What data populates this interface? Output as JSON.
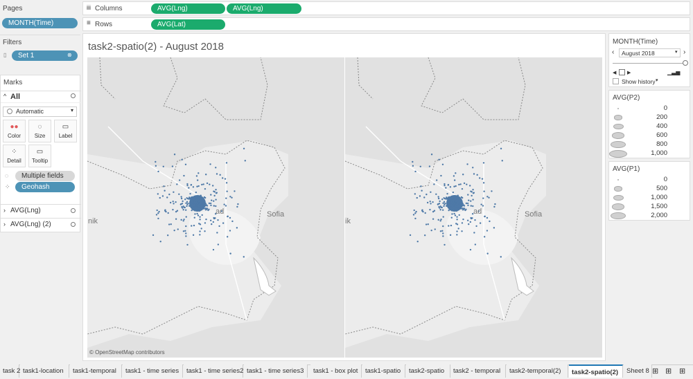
{
  "shelves": {
    "pages_label": "Pages",
    "pages_pill": "MONTH(Time)",
    "filters_label": "Filters",
    "filters_pill": "Set 1",
    "columns_label": "Columns",
    "columns_pills": [
      "AVG(Lng)",
      "AVG(Lng)"
    ],
    "rows_label": "Rows",
    "rows_pills": [
      "AVG(Lat)"
    ]
  },
  "marks": {
    "label": "Marks",
    "all_label": "All",
    "type_select": "Automatic",
    "buttons": [
      "Color",
      "Size",
      "Label",
      "Detail",
      "Tooltip"
    ],
    "pills": [
      "Multiple fields",
      "Geohash"
    ],
    "sub_cards": [
      "AVG(Lng)",
      "AVG(Lng) (2)"
    ]
  },
  "view": {
    "title": "task2-spatio(2) - August 2018",
    "cities": [
      "Sofia",
      "Sofia"
    ],
    "partial_labels": [
      "nik",
      "ad",
      "ik",
      "ad"
    ],
    "attribution": "© OpenStreetMap contributors",
    "point_color": "#4e79a7"
  },
  "page_control": {
    "title": "MONTH(Time)",
    "value": "August 2018",
    "show_history": "Show history"
  },
  "legend_p2": {
    "title": "AVG(P2)",
    "values": [
      "0",
      "200",
      "400",
      "600",
      "800",
      "1,000"
    ]
  },
  "legend_p1": {
    "title": "AVG(P1)",
    "values": [
      "0",
      "500",
      "1,000",
      "1,500",
      "2,000"
    ]
  },
  "tabs": {
    "items": [
      "task 2",
      "task1-location",
      "task1-temporal",
      "task1 - time series",
      "task1 - time series2",
      "task1 - time series3",
      "task1 - box plot",
      "task1-spatio",
      "task2-spatio",
      "task2 - temporal",
      "task2-temporal(2)",
      "task2-spatio(2)",
      "Sheet 8"
    ],
    "active_index": 11
  }
}
